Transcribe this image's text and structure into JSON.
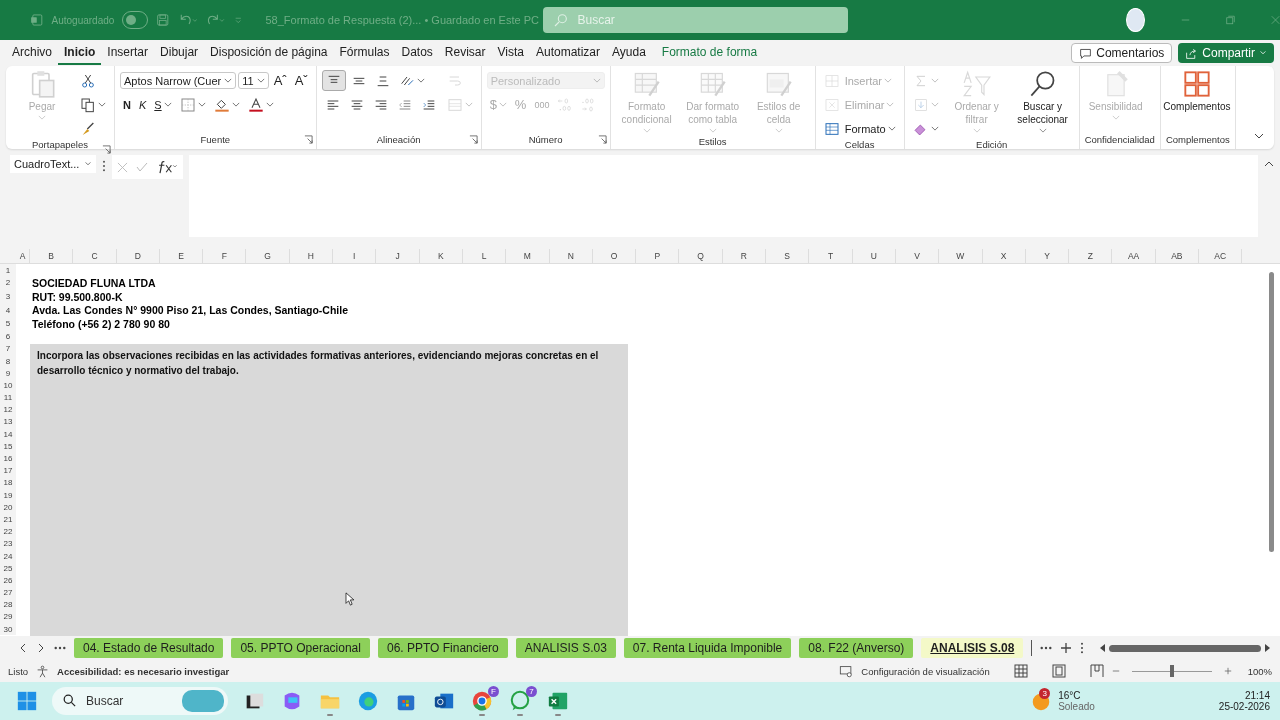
{
  "title_bar": {
    "autosave_label": "Autoguardado",
    "autosave_on": false,
    "document_title": "58_Formato de Respuesta (2)... • Guardado en Este PC",
    "search_placeholder": "Buscar"
  },
  "menu_tabs": [
    {
      "label": "Archivo",
      "selected": false,
      "kind": "standard"
    },
    {
      "label": "Inicio",
      "selected": true,
      "kind": "standard"
    },
    {
      "label": "Insertar",
      "selected": false,
      "kind": "standard"
    },
    {
      "label": "Dibujar",
      "selected": false,
      "kind": "standard"
    },
    {
      "label": "Disposición de página",
      "selected": false,
      "kind": "standard"
    },
    {
      "label": "Fórmulas",
      "selected": false,
      "kind": "standard"
    },
    {
      "label": "Datos",
      "selected": false,
      "kind": "standard"
    },
    {
      "label": "Revisar",
      "selected": false,
      "kind": "standard"
    },
    {
      "label": "Vista",
      "selected": false,
      "kind": "standard"
    },
    {
      "label": "Automatizar",
      "selected": false,
      "kind": "standard"
    },
    {
      "label": "Ayuda",
      "selected": false,
      "kind": "standard"
    },
    {
      "label": "Formato de forma",
      "selected": false,
      "kind": "contextual"
    }
  ],
  "comments_button": "Comentarios",
  "share_button": "Compartir",
  "ribbon_groups": [
    {
      "label": "Portapapeles",
      "launcher": true,
      "blocks": [
        {
          "kind": "large",
          "tool": {
            "kind": "paste",
            "label": "Pegar",
            "disabled": true,
            "dropdown": true
          }
        },
        {
          "kind": "stack",
          "rows": [
            {
              "tools": [
                {
                  "kind": "cut",
                  "disabled": false,
                  "dropdown": false
                }
              ]
            },
            {
              "tools": [
                {
                  "kind": "copy",
                  "disabled": false,
                  "dropdown": true
                }
              ]
            },
            {
              "tools": [
                {
                  "kind": "brush",
                  "disabled": false,
                  "dropdown": false
                }
              ]
            }
          ]
        }
      ]
    },
    {
      "label": "Fuente",
      "launcher": true,
      "blocks": [
        {
          "kind": "stack",
          "rows": [
            {
              "tools": [
                {
                  "kind": "field",
                  "text": "Aptos Narrow (Cuer",
                  "disabled": false,
                  "dropdown": true
                },
                {
                  "kind": "field",
                  "text": "11",
                  "disabled": false,
                  "dropdown": true
                },
                {
                  "kind": "glyph",
                  "text": "Aˆ",
                  "disabled": false,
                  "dropdown": false
                },
                {
                  "kind": "glyph",
                  "text": "Aˇ",
                  "disabled": false,
                  "dropdown": false
                }
              ]
            },
            {
              "tools": [
                {
                  "kind": "bold",
                  "text": "N",
                  "disabled": false,
                  "dropdown": false
                },
                {
                  "kind": "italic",
                  "text": "K",
                  "disabled": false,
                  "dropdown": false
                },
                {
                  "kind": "underline",
                  "text": "S",
                  "disabled": false,
                  "dropdown": true
                },
                {
                  "kind": "borders",
                  "disabled": false,
                  "dropdown": true
                },
                {
                  "kind": "fill",
                  "disabled": false,
                  "dropdown": true
                },
                {
                  "kind": "fontcolor",
                  "disabled": false,
                  "dropdown": true
                }
              ]
            }
          ]
        }
      ]
    },
    {
      "label": "Alineación",
      "launcher": true,
      "blocks": [
        {
          "kind": "stack",
          "rows": [
            {
              "tools": [
                {
                  "kind": "aligntop",
                  "selected": true,
                  "disabled": false,
                  "dropdown": false
                },
                {
                  "kind": "alignmiddle",
                  "selected": false,
                  "disabled": false,
                  "dropdown": false
                },
                {
                  "kind": "alignbottom",
                  "selected": false,
                  "disabled": false,
                  "dropdown": false
                },
                {
                  "kind": "orientation",
                  "disabled": false,
                  "dropdown": true
                }
              ]
            },
            {
              "tools": [
                {
                  "kind": "alignleft",
                  "selected": false,
                  "disabled": false,
                  "dropdown": false
                },
                {
                  "kind": "aligncenter",
                  "selected": false,
                  "disabled": false,
                  "dropdown": false
                },
                {
                  "kind": "alignright",
                  "selected": false,
                  "disabled": false,
                  "dropdown": false
                },
                {
                  "kind": "indentless",
                  "disabled": false,
                  "dropdown": false
                },
                {
                  "kind": "indentmore",
                  "disabled": false,
                  "dropdown": false
                }
              ]
            }
          ]
        },
        {
          "kind": "stack",
          "rows": [
            {
              "tools": [
                {
                  "kind": "wrap",
                  "disabled": true,
                  "dropdown": false
                }
              ]
            },
            {
              "tools": [
                {
                  "kind": "merge",
                  "disabled": true,
                  "dropdown": true
                }
              ]
            }
          ]
        }
      ]
    },
    {
      "label": "Número",
      "launcher": true,
      "blocks": [
        {
          "kind": "stack",
          "rows": [
            {
              "tools": [
                {
                  "kind": "field",
                  "text": "Personalizado",
                  "disabled": true,
                  "dropdown": true
                }
              ]
            },
            {
              "tools": [
                {
                  "kind": "glyph",
                  "text": "$",
                  "disabled": true,
                  "dropdown": true
                },
                {
                  "kind": "glyph",
                  "text": "%",
                  "disabled": true,
                  "dropdown": false
                },
                {
                  "kind": "smallglyph",
                  "text": "000",
                  "disabled": true,
                  "dropdown": false
                },
                {
                  "kind": "decimalmore",
                  "disabled": true,
                  "dropdown": false
                },
                {
                  "kind": "decimalless",
                  "disabled": true,
                  "dropdown": false
                }
              ]
            }
          ]
        }
      ]
    },
    {
      "label": "Estilos",
      "launcher": false,
      "blocks": [
        {
          "kind": "large",
          "tool": {
            "kind": "conditional",
            "label": "Formato condicional",
            "disabled": true,
            "dropdown": true
          }
        },
        {
          "kind": "large",
          "tool": {
            "kind": "table",
            "label": "Dar formato como tabla",
            "disabled": true,
            "dropdown": true
          }
        },
        {
          "kind": "large",
          "tool": {
            "kind": "cellstyle",
            "label": "Estilos de celda",
            "disabled": true,
            "dropdown": true
          }
        }
      ]
    },
    {
      "label": "Celdas",
      "launcher": false,
      "blocks": [
        {
          "kind": "stack",
          "rows": [
            {
              "tools": [
                {
                  "kind": "insert",
                  "label": "Insertar",
                  "disabled": true,
                  "dropdown": true
                }
              ]
            },
            {
              "tools": [
                {
                  "kind": "delete",
                  "label": "Eliminar",
                  "disabled": true,
                  "dropdown": true
                }
              ]
            },
            {
              "tools": [
                {
                  "kind": "format",
                  "label": "Formato",
                  "disabled": false,
                  "dropdown": true
                }
              ]
            }
          ]
        }
      ]
    },
    {
      "label": "Edición",
      "launcher": false,
      "blocks": [
        {
          "kind": "stack",
          "rows": [
            {
              "tools": [
                {
                  "kind": "sum",
                  "disabled": true,
                  "dropdown": true
                }
              ]
            },
            {
              "tools": [
                {
                  "kind": "filldown",
                  "disabled": true,
                  "dropdown": true
                }
              ]
            },
            {
              "tools": [
                {
                  "kind": "eraser",
                  "disabled": false,
                  "dropdown": true
                }
              ]
            }
          ]
        },
        {
          "kind": "large",
          "tool": {
            "kind": "sort",
            "label": "Ordenar y filtrar",
            "disabled": true,
            "dropdown": true
          }
        },
        {
          "kind": "large",
          "tool": {
            "kind": "find",
            "label": "Buscar y seleccionar",
            "disabled": false,
            "dropdown": true
          }
        }
      ]
    },
    {
      "label": "Confidencialidad",
      "launcher": false,
      "blocks": [
        {
          "kind": "large",
          "tool": {
            "kind": "sensitivity",
            "label": "Sensibilidad",
            "disabled": true,
            "dropdown": true
          }
        }
      ]
    },
    {
      "label": "Complementos",
      "launcher": false,
      "blocks": [
        {
          "kind": "large",
          "tool": {
            "kind": "addins",
            "label": "Complementos",
            "disabled": false,
            "dropdown": false
          }
        }
      ]
    }
  ],
  "name_box": "CuadroText...",
  "columns": [
    "A",
    "B",
    "C",
    "D",
    "E",
    "F",
    "G",
    "H",
    "I",
    "J",
    "K",
    "L",
    "M",
    "N",
    "O",
    "P",
    "Q",
    "R",
    "S",
    "T",
    "U",
    "V",
    "W",
    "X",
    "Y",
    "Z",
    "AA",
    "AB",
    "AC"
  ],
  "rows": [
    {
      "number": "1"
    },
    {
      "number": "2",
      "text": "SOCIEDAD FLUNA LTDA"
    },
    {
      "number": "3",
      "text": "RUT: 99.500.800-K"
    },
    {
      "number": "4",
      "text": "Avda. Las Condes N° 9900 Piso 21, Las Condes, Santiago-Chile"
    },
    {
      "number": "5",
      "text": "Teléfono (+56 2) 2 780 90 80"
    },
    {
      "number": "6"
    },
    {
      "number": "7"
    },
    {
      "number": "8"
    },
    {
      "number": "9"
    },
    {
      "number": "10"
    },
    {
      "number": "11"
    },
    {
      "number": "12"
    },
    {
      "number": "13"
    },
    {
      "number": "14"
    },
    {
      "number": "15"
    },
    {
      "number": "16"
    },
    {
      "number": "17"
    },
    {
      "number": "18"
    },
    {
      "number": "19"
    },
    {
      "number": "20"
    },
    {
      "number": "21"
    },
    {
      "number": "22"
    },
    {
      "number": "23"
    },
    {
      "number": "24"
    },
    {
      "number": "25"
    },
    {
      "number": "26"
    },
    {
      "number": "27"
    },
    {
      "number": "28"
    },
    {
      "number": "29"
    },
    {
      "number": "30"
    }
  ],
  "text_box": "Incorpora las observaciones recibidas en las actividades formativas anteriores, evidenciando mejoras concretas en el desarrollo técnico y normativo del trabajo.",
  "sheet_tabs": [
    {
      "label": "04. Estado de Resultado",
      "selected": false
    },
    {
      "label": "05. PPTO Operacional",
      "selected": false
    },
    {
      "label": "06. PPTO Financiero",
      "selected": false
    },
    {
      "label": "ANALISIS S.03",
      "selected": false
    },
    {
      "label": "07. Renta Liquida Imponible",
      "selected": false
    },
    {
      "label": "08. F22 (Anverso)",
      "selected": false
    },
    {
      "label": "ANALISIS S.08",
      "selected": true
    }
  ],
  "status_bar": {
    "ready": "Listo",
    "accessibility": "Accesibilidad: es necesario investigar",
    "display_settings": "Configuración de visualización",
    "zoom": "100%",
    "zoom_level": {
      "level": 0.5
    }
  },
  "taskbar": {
    "search_placeholder": "Buscar",
    "apps": [
      {
        "kind": "taskview",
        "running": false
      },
      {
        "kind": "copilot",
        "running": false
      },
      {
        "kind": "explorer",
        "running": true
      },
      {
        "kind": "edge",
        "running": false
      },
      {
        "kind": "store",
        "running": false
      },
      {
        "kind": "outlook",
        "running": false
      },
      {
        "kind": "chrome",
        "running": true,
        "badge": "F"
      },
      {
        "kind": "whatsapp",
        "running": true,
        "badge": "7"
      },
      {
        "kind": "excel",
        "running": true
      }
    ],
    "weather_badge": "3",
    "temperature": "16°C",
    "weather": "Soleado",
    "time": "21:14",
    "date": "25-02-2026"
  }
}
